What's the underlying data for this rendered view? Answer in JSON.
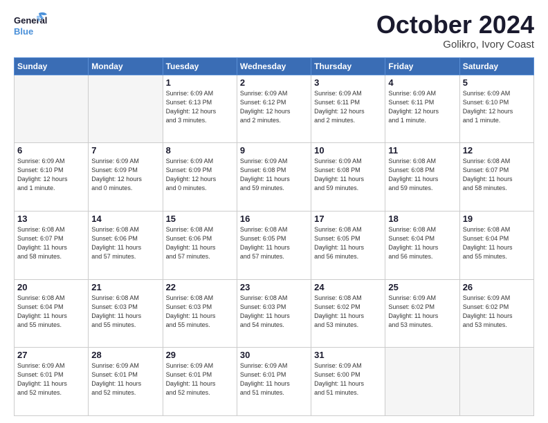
{
  "logo": {
    "line1": "General",
    "line2": "Blue",
    "tagline": ""
  },
  "title": {
    "month": "October 2024",
    "location": "Golikro, Ivory Coast"
  },
  "weekdays": [
    "Sunday",
    "Monday",
    "Tuesday",
    "Wednesday",
    "Thursday",
    "Friday",
    "Saturday"
  ],
  "weeks": [
    [
      {
        "day": "",
        "info": ""
      },
      {
        "day": "",
        "info": ""
      },
      {
        "day": "1",
        "info": "Sunrise: 6:09 AM\nSunset: 6:13 PM\nDaylight: 12 hours\nand 3 minutes."
      },
      {
        "day": "2",
        "info": "Sunrise: 6:09 AM\nSunset: 6:12 PM\nDaylight: 12 hours\nand 2 minutes."
      },
      {
        "day": "3",
        "info": "Sunrise: 6:09 AM\nSunset: 6:11 PM\nDaylight: 12 hours\nand 2 minutes."
      },
      {
        "day": "4",
        "info": "Sunrise: 6:09 AM\nSunset: 6:11 PM\nDaylight: 12 hours\nand 1 minute."
      },
      {
        "day": "5",
        "info": "Sunrise: 6:09 AM\nSunset: 6:10 PM\nDaylight: 12 hours\nand 1 minute."
      }
    ],
    [
      {
        "day": "6",
        "info": "Sunrise: 6:09 AM\nSunset: 6:10 PM\nDaylight: 12 hours\nand 1 minute."
      },
      {
        "day": "7",
        "info": "Sunrise: 6:09 AM\nSunset: 6:09 PM\nDaylight: 12 hours\nand 0 minutes."
      },
      {
        "day": "8",
        "info": "Sunrise: 6:09 AM\nSunset: 6:09 PM\nDaylight: 12 hours\nand 0 minutes."
      },
      {
        "day": "9",
        "info": "Sunrise: 6:09 AM\nSunset: 6:08 PM\nDaylight: 11 hours\nand 59 minutes."
      },
      {
        "day": "10",
        "info": "Sunrise: 6:09 AM\nSunset: 6:08 PM\nDaylight: 11 hours\nand 59 minutes."
      },
      {
        "day": "11",
        "info": "Sunrise: 6:08 AM\nSunset: 6:08 PM\nDaylight: 11 hours\nand 59 minutes."
      },
      {
        "day": "12",
        "info": "Sunrise: 6:08 AM\nSunset: 6:07 PM\nDaylight: 11 hours\nand 58 minutes."
      }
    ],
    [
      {
        "day": "13",
        "info": "Sunrise: 6:08 AM\nSunset: 6:07 PM\nDaylight: 11 hours\nand 58 minutes."
      },
      {
        "day": "14",
        "info": "Sunrise: 6:08 AM\nSunset: 6:06 PM\nDaylight: 11 hours\nand 57 minutes."
      },
      {
        "day": "15",
        "info": "Sunrise: 6:08 AM\nSunset: 6:06 PM\nDaylight: 11 hours\nand 57 minutes."
      },
      {
        "day": "16",
        "info": "Sunrise: 6:08 AM\nSunset: 6:05 PM\nDaylight: 11 hours\nand 57 minutes."
      },
      {
        "day": "17",
        "info": "Sunrise: 6:08 AM\nSunset: 6:05 PM\nDaylight: 11 hours\nand 56 minutes."
      },
      {
        "day": "18",
        "info": "Sunrise: 6:08 AM\nSunset: 6:04 PM\nDaylight: 11 hours\nand 56 minutes."
      },
      {
        "day": "19",
        "info": "Sunrise: 6:08 AM\nSunset: 6:04 PM\nDaylight: 11 hours\nand 55 minutes."
      }
    ],
    [
      {
        "day": "20",
        "info": "Sunrise: 6:08 AM\nSunset: 6:04 PM\nDaylight: 11 hours\nand 55 minutes."
      },
      {
        "day": "21",
        "info": "Sunrise: 6:08 AM\nSunset: 6:03 PM\nDaylight: 11 hours\nand 55 minutes."
      },
      {
        "day": "22",
        "info": "Sunrise: 6:08 AM\nSunset: 6:03 PM\nDaylight: 11 hours\nand 55 minutes."
      },
      {
        "day": "23",
        "info": "Sunrise: 6:08 AM\nSunset: 6:03 PM\nDaylight: 11 hours\nand 54 minutes."
      },
      {
        "day": "24",
        "info": "Sunrise: 6:08 AM\nSunset: 6:02 PM\nDaylight: 11 hours\nand 53 minutes."
      },
      {
        "day": "25",
        "info": "Sunrise: 6:09 AM\nSunset: 6:02 PM\nDaylight: 11 hours\nand 53 minutes."
      },
      {
        "day": "26",
        "info": "Sunrise: 6:09 AM\nSunset: 6:02 PM\nDaylight: 11 hours\nand 53 minutes."
      }
    ],
    [
      {
        "day": "27",
        "info": "Sunrise: 6:09 AM\nSunset: 6:01 PM\nDaylight: 11 hours\nand 52 minutes."
      },
      {
        "day": "28",
        "info": "Sunrise: 6:09 AM\nSunset: 6:01 PM\nDaylight: 11 hours\nand 52 minutes."
      },
      {
        "day": "29",
        "info": "Sunrise: 6:09 AM\nSunset: 6:01 PM\nDaylight: 11 hours\nand 52 minutes."
      },
      {
        "day": "30",
        "info": "Sunrise: 6:09 AM\nSunset: 6:01 PM\nDaylight: 11 hours\nand 51 minutes."
      },
      {
        "day": "31",
        "info": "Sunrise: 6:09 AM\nSunset: 6:00 PM\nDaylight: 11 hours\nand 51 minutes."
      },
      {
        "day": "",
        "info": ""
      },
      {
        "day": "",
        "info": ""
      }
    ]
  ]
}
